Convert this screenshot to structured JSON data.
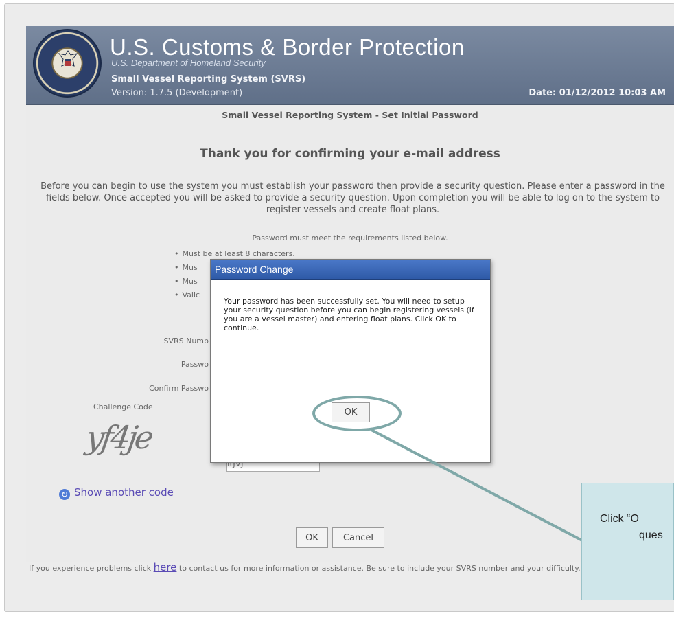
{
  "banner": {
    "title": "U.S. Customs & Border Protection",
    "subtitle": "U.S. Department of Homeland Security",
    "system_name": "Small Vessel Reporting System (SVRS)",
    "version": "Version: 1.7.5 (Development)",
    "date": "Date: 01/12/2012 10:03 AM",
    "seal_icon": "dhs-seal-icon"
  },
  "page": {
    "subtitle": "Small Vessel Reporting System - Set Initial Password",
    "thanks": "Thank you for confirming your e-mail address",
    "intro": "Before you can begin to use the system you must establish your password then provide a security question. Please enter a password in the fields below. Once accepted you will be asked to provide a security question. Upon completion you will be able to log on to the system to register vessels and create float plans.",
    "requirements_title": "Password must meet the requirements listed below.",
    "requirements": [
      "Must be at least 8 characters.",
      "Mus",
      "Mus",
      "Valic"
    ]
  },
  "form": {
    "svrs_label": "SVRS Numb",
    "password_label": "Passwo",
    "confirm_label": "Confirm Passwo",
    "captcha_label": "Challenge Code",
    "captcha_text": "yf4je",
    "show_another": "Show another code",
    "code_value": "ItJVJ",
    "ok": "OK",
    "cancel": "Cancel"
  },
  "footer": {
    "before": "If you experience problems click",
    "link": "here",
    "after": "to contact us for more information or assistance. Be sure to include your SVRS number and your difficulty."
  },
  "modal": {
    "title": "Password Change",
    "message": "Your password has been successfully set. You will need to setup your security question before you can begin registering vessels (if you are a vessel master) and entering float plans. Click OK to continue.",
    "ok": "OK"
  },
  "callout": {
    "line1": "Click “O",
    "line2": "ques"
  }
}
